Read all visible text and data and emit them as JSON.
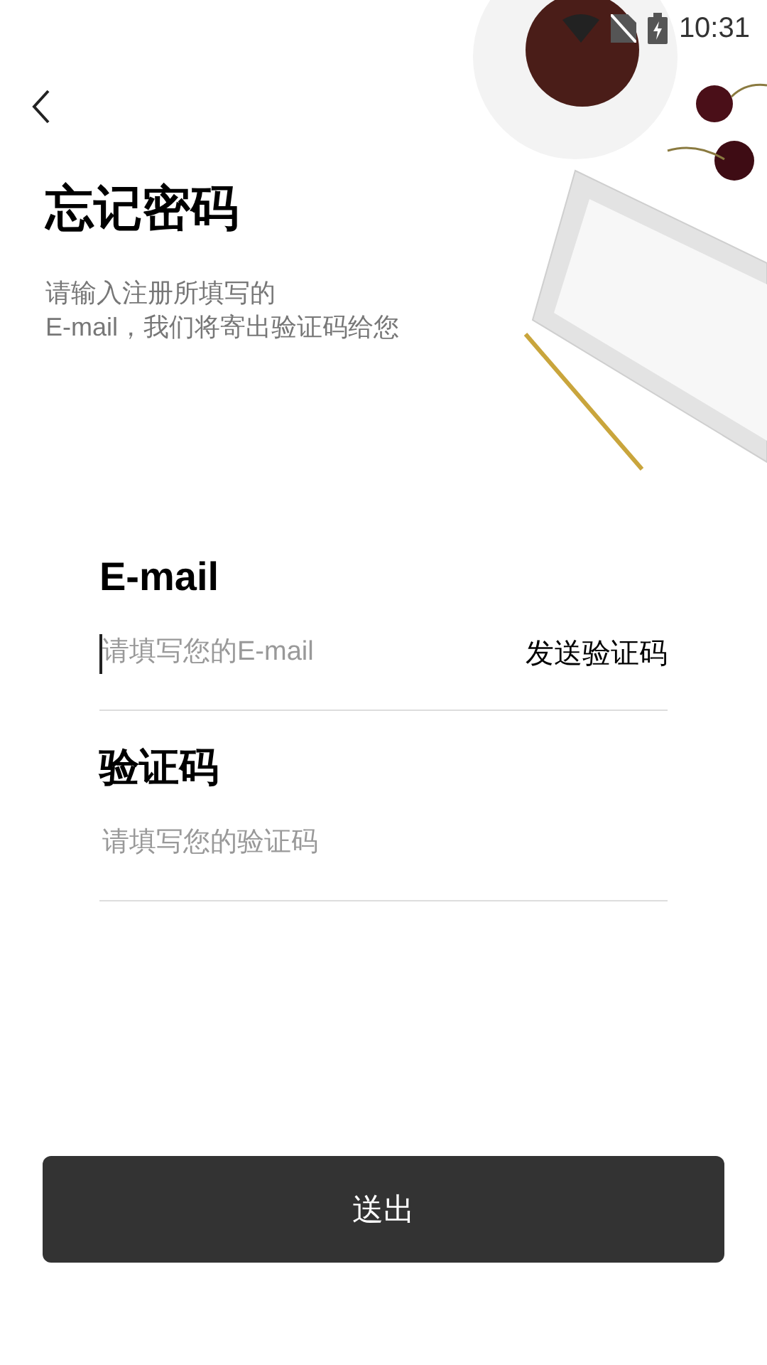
{
  "status_bar": {
    "time": "10:31"
  },
  "title": "忘记密码",
  "subtitle": "请输入注册所填写的\nE-mail，我们将寄出验证码给您",
  "fields": [
    {
      "label": "E-mail",
      "placeholder": "请填写您的E-mail",
      "focused": true,
      "action": "发送验证码"
    },
    {
      "label": "验证码",
      "placeholder": "请填写您的验证码",
      "focused": false
    }
  ],
  "submit": "送出"
}
